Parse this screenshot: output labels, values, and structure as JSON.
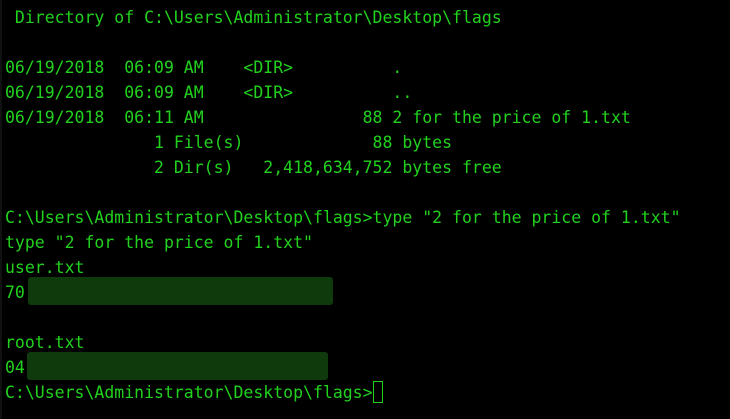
{
  "terminal": {
    "colors": {
      "background": "#000000",
      "text": "#22d11e",
      "redaction": "#0d3b0b"
    },
    "lines": [
      " Directory of C:\\Users\\Administrator\\Desktop\\flags",
      "06/19/2018  06:09 AM    <DIR>          .",
      "06/19/2018  06:09 AM    <DIR>          ..",
      "06/19/2018  06:11 AM                88 2 for the price of 1.txt",
      "               1 File(s)             88 bytes",
      "               2 Dir(s)   2,418,634,752 bytes free",
      "C:\\Users\\Administrator\\Desktop\\flags>type \"2 for the price of 1.txt\"",
      "type \"2 for the price of 1.txt\"",
      "user.txt",
      "70",
      "root.txt",
      "04",
      "C:\\Users\\Administrator\\Desktop\\flags>"
    ]
  }
}
